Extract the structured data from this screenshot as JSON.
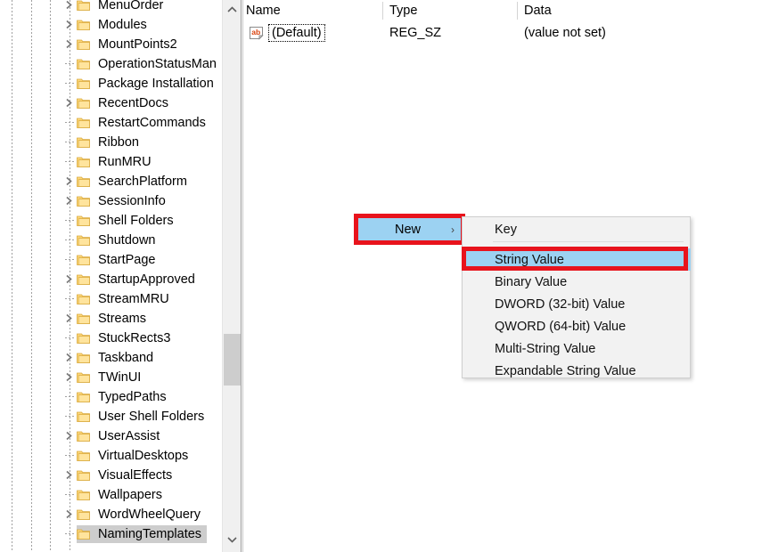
{
  "tree": {
    "selected_key": "NamingTemplates",
    "items": [
      {
        "label": "MenuOrder",
        "expandable": true,
        "indent": 3
      },
      {
        "label": "Modules",
        "expandable": true,
        "indent": 3
      },
      {
        "label": "MountPoints2",
        "expandable": true,
        "indent": 3
      },
      {
        "label": "OperationStatusMan",
        "expandable": false,
        "indent": 3
      },
      {
        "label": "Package Installation",
        "expandable": false,
        "indent": 3
      },
      {
        "label": "RecentDocs",
        "expandable": true,
        "indent": 3
      },
      {
        "label": "RestartCommands",
        "expandable": false,
        "indent": 3
      },
      {
        "label": "Ribbon",
        "expandable": false,
        "indent": 3
      },
      {
        "label": "RunMRU",
        "expandable": false,
        "indent": 3
      },
      {
        "label": "SearchPlatform",
        "expandable": true,
        "indent": 3
      },
      {
        "label": "SessionInfo",
        "expandable": true,
        "indent": 3
      },
      {
        "label": "Shell Folders",
        "expandable": false,
        "indent": 3
      },
      {
        "label": "Shutdown",
        "expandable": false,
        "indent": 3
      },
      {
        "label": "StartPage",
        "expandable": false,
        "indent": 3
      },
      {
        "label": "StartupApproved",
        "expandable": true,
        "indent": 3
      },
      {
        "label": "StreamMRU",
        "expandable": false,
        "indent": 3
      },
      {
        "label": "Streams",
        "expandable": true,
        "indent": 3
      },
      {
        "label": "StuckRects3",
        "expandable": false,
        "indent": 3
      },
      {
        "label": "Taskband",
        "expandable": true,
        "indent": 3
      },
      {
        "label": "TWinUI",
        "expandable": true,
        "indent": 3
      },
      {
        "label": "TypedPaths",
        "expandable": false,
        "indent": 3
      },
      {
        "label": "User Shell Folders",
        "expandable": false,
        "indent": 3
      },
      {
        "label": "UserAssist",
        "expandable": true,
        "indent": 3
      },
      {
        "label": "VirtualDesktops",
        "expandable": false,
        "indent": 3
      },
      {
        "label": "VisualEffects",
        "expandable": true,
        "indent": 3
      },
      {
        "label": "Wallpapers",
        "expandable": false,
        "indent": 3
      },
      {
        "label": "WordWheelQuery",
        "expandable": true,
        "indent": 3
      },
      {
        "label": "NamingTemplates",
        "expandable": false,
        "indent": 3
      }
    ],
    "scrollbar": {
      "up_arrow": "chevron-up-icon",
      "down_arrow": "chevron-down-icon"
    }
  },
  "values": {
    "columns": [
      "Name",
      "Type",
      "Data"
    ],
    "rows": [
      {
        "icon": "ab-string-icon",
        "name": "(Default)",
        "type": "REG_SZ",
        "data": "(value not set)"
      }
    ]
  },
  "context_menu": {
    "parent_item": {
      "label": "New",
      "submenu_arrow": "chevron-right-icon",
      "highlighted": true
    },
    "submenu_items": [
      {
        "label": "Key",
        "highlighted": false
      },
      {
        "label": "String Value",
        "highlighted": true
      },
      {
        "label": "Binary Value",
        "highlighted": false
      },
      {
        "label": "DWORD (32-bit) Value",
        "highlighted": false
      },
      {
        "label": "QWORD (64-bit) Value",
        "highlighted": false
      },
      {
        "label": "Multi-String Value",
        "highlighted": false
      },
      {
        "label": "Expandable String Value",
        "highlighted": false
      }
    ]
  },
  "annotations": {
    "color": "#e8131c",
    "boxes": [
      "new-menu-item",
      "string-value-item"
    ]
  },
  "colors": {
    "menu_highlight": "#9cd2f2",
    "tree_selection": "#cdcdcd",
    "menu_background": "#f2f2f2",
    "scrollbar_thumb": "#cdcdcd"
  }
}
